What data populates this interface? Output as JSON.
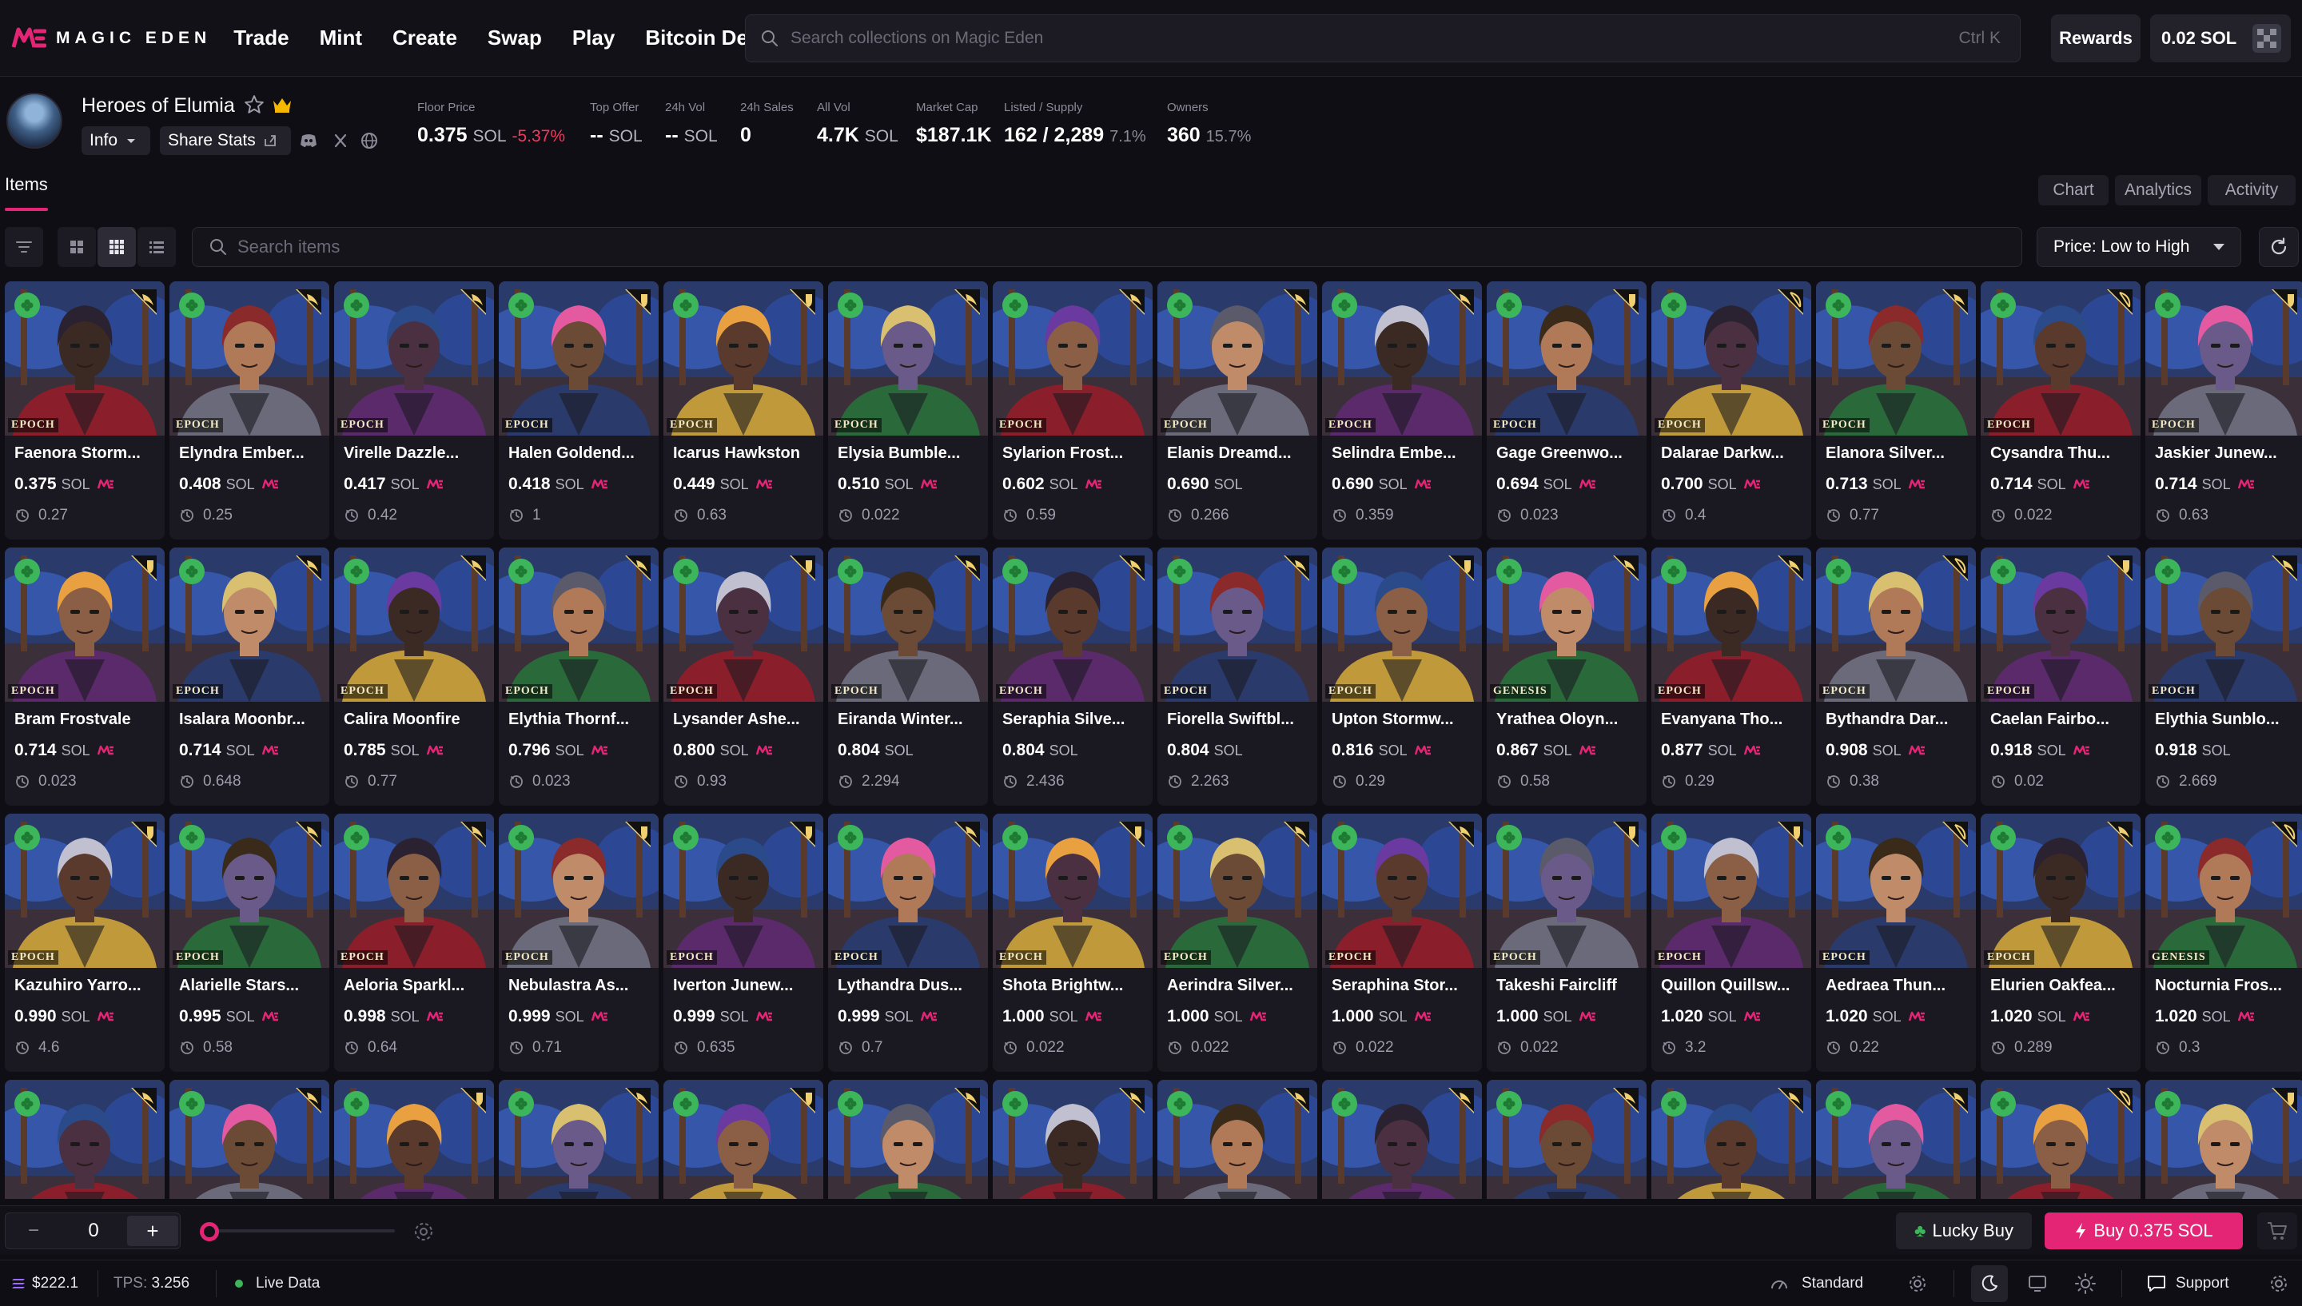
{
  "nav": {
    "brand": "MAGIC EDEN",
    "links": [
      "Trade",
      "Mint",
      "Create",
      "Swap",
      "Play",
      "Bitcoin DeFi"
    ],
    "search_placeholder": "Search collections on Magic Eden",
    "search_shortcut": "Ctrl K",
    "rewards_label": "Rewards",
    "wallet_balance": "0.02 SOL"
  },
  "collection": {
    "name": "Heroes of Elumia",
    "info_label": "Info",
    "share_label": "Share Stats",
    "stats": [
      {
        "label": "Floor Price",
        "value": "0.375",
        "unit": "SOL",
        "change": "-5.37%"
      },
      {
        "label": "Top Offer",
        "value": "--",
        "unit": "SOL"
      },
      {
        "label": "24h Vol",
        "value": "--",
        "unit": "SOL"
      },
      {
        "label": "24h Sales",
        "value": "0"
      },
      {
        "label": "All Vol",
        "value": "4.7K",
        "unit": "SOL"
      },
      {
        "label": "Market Cap",
        "value": "$187.1K"
      },
      {
        "label": "Listed / Supply",
        "value": "162 / 2,289",
        "pct": "7.1%"
      },
      {
        "label": "Owners",
        "value": "360",
        "pct": "15.7%"
      }
    ]
  },
  "tabs": {
    "items_label": "Items",
    "chart_label": "Chart",
    "analytics_label": "Analytics",
    "activity_label": "Activity"
  },
  "toolbar": {
    "search_placeholder": "Search items",
    "sort_label": "Price: Low to High"
  },
  "items": [
    {
      "name": "Faenora Storm...",
      "price": "0.375",
      "offer": "0.27",
      "badge": "EPOCH",
      "me": true,
      "icon": "wing"
    },
    {
      "name": "Elyndra Ember...",
      "price": "0.408",
      "offer": "0.25",
      "badge": "EPOCH",
      "me": true,
      "icon": "wing"
    },
    {
      "name": "Virelle Dazzle...",
      "price": "0.417",
      "offer": "0.42",
      "badge": "EPOCH",
      "me": true,
      "icon": "wing"
    },
    {
      "name": "Halen Goldend...",
      "price": "0.418",
      "offer": "1",
      "badge": "EPOCH",
      "me": true,
      "icon": "shield"
    },
    {
      "name": "Icarus Hawkston",
      "price": "0.449",
      "offer": "0.63",
      "badge": "EPOCH",
      "me": true,
      "icon": "shield"
    },
    {
      "name": "Elysia Bumble...",
      "price": "0.510",
      "offer": "0.022",
      "badge": "EPOCH",
      "me": true,
      "icon": "wing"
    },
    {
      "name": "Sylarion Frost...",
      "price": "0.602",
      "offer": "0.59",
      "badge": "EPOCH",
      "me": true,
      "icon": "wing"
    },
    {
      "name": "Elanis Dreamd...",
      "price": "0.690",
      "offer": "0.266",
      "badge": "EPOCH",
      "me": false,
      "icon": "wing"
    },
    {
      "name": "Selindra Embe...",
      "price": "0.690",
      "offer": "0.359",
      "badge": "EPOCH",
      "me": true,
      "icon": "wing"
    },
    {
      "name": "Gage Greenwo...",
      "price": "0.694",
      "offer": "0.023",
      "badge": "EPOCH",
      "me": true,
      "icon": "shield"
    },
    {
      "name": "Dalarae Darkw...",
      "price": "0.700",
      "offer": "0.4",
      "badge": "EPOCH",
      "me": true,
      "icon": "bow"
    },
    {
      "name": "Elanora Silver...",
      "price": "0.713",
      "offer": "0.77",
      "badge": "EPOCH",
      "me": true,
      "icon": "wing"
    },
    {
      "name": "Cysandra Thu...",
      "price": "0.714",
      "offer": "0.022",
      "badge": "EPOCH",
      "me": true,
      "icon": "bow"
    },
    {
      "name": "Jaskier Junew...",
      "price": "0.714",
      "offer": "0.63",
      "badge": "EPOCH",
      "me": true,
      "icon": "shield"
    },
    {
      "name": "Bram Frostvale",
      "price": "0.714",
      "offer": "0.023",
      "badge": "EPOCH",
      "me": true,
      "icon": "shield"
    },
    {
      "name": "Isalara Moonbr...",
      "price": "0.714",
      "offer": "0.648",
      "badge": "EPOCH",
      "me": true,
      "icon": "wing"
    },
    {
      "name": "Calira Moonfire",
      "price": "0.785",
      "offer": "0.77",
      "badge": "EPOCH",
      "me": true,
      "icon": "wing"
    },
    {
      "name": "Elythia Thornf...",
      "price": "0.796",
      "offer": "0.023",
      "badge": "EPOCH",
      "me": true,
      "icon": "wing"
    },
    {
      "name": "Lysander Ashe...",
      "price": "0.800",
      "offer": "0.93",
      "badge": "EPOCH",
      "me": true,
      "icon": "shield"
    },
    {
      "name": "Eiranda Winter...",
      "price": "0.804",
      "offer": "2.294",
      "badge": "EPOCH",
      "me": false,
      "icon": "wing"
    },
    {
      "name": "Seraphia Silve...",
      "price": "0.804",
      "offer": "2.436",
      "badge": "EPOCH",
      "me": false,
      "icon": "wing"
    },
    {
      "name": "Fiorella Swiftbl...",
      "price": "0.804",
      "offer": "2.263",
      "badge": "EPOCH",
      "me": false,
      "icon": "wing"
    },
    {
      "name": "Upton Stormw...",
      "price": "0.816",
      "offer": "0.29",
      "badge": "EPOCH",
      "me": true,
      "icon": "shield"
    },
    {
      "name": "Yrathea Oloyn...",
      "price": "0.867",
      "offer": "0.58",
      "badge": "GENESIS",
      "me": true,
      "icon": "wing"
    },
    {
      "name": "Evanyana Tho...",
      "price": "0.877",
      "offer": "0.29",
      "badge": "EPOCH",
      "me": true,
      "icon": "wing"
    },
    {
      "name": "Bythandra Dar...",
      "price": "0.908",
      "offer": "0.38",
      "badge": "EPOCH",
      "me": true,
      "icon": "bow"
    },
    {
      "name": "Caelan Fairbo...",
      "price": "0.918",
      "offer": "0.02",
      "badge": "EPOCH",
      "me": true,
      "icon": "shield"
    },
    {
      "name": "Elythia Sunblo...",
      "price": "0.918",
      "offer": "2.669",
      "badge": "EPOCH",
      "me": false,
      "icon": "wing"
    },
    {
      "name": "Kazuhiro Yarro...",
      "price": "0.990",
      "offer": "4.6",
      "badge": "EPOCH",
      "me": true,
      "icon": "shield"
    },
    {
      "name": "Alarielle Stars...",
      "price": "0.995",
      "offer": "0.58",
      "badge": "EPOCH",
      "me": true,
      "icon": "wing"
    },
    {
      "name": "Aeloria Sparkl...",
      "price": "0.998",
      "offer": "0.64",
      "badge": "EPOCH",
      "me": true,
      "icon": "wing"
    },
    {
      "name": "Nebulastra As...",
      "price": "0.999",
      "offer": "0.71",
      "badge": "EPOCH",
      "me": true,
      "icon": "shield"
    },
    {
      "name": "Iverton Junew...",
      "price": "0.999",
      "offer": "0.635",
      "badge": "EPOCH",
      "me": true,
      "icon": "shield"
    },
    {
      "name": "Lythandra Dus...",
      "price": "0.999",
      "offer": "0.7",
      "badge": "EPOCH",
      "me": true,
      "icon": "wing"
    },
    {
      "name": "Shota Brightw...",
      "price": "1.000",
      "offer": "0.022",
      "badge": "EPOCH",
      "me": true,
      "icon": "shield"
    },
    {
      "name": "Aerindra Silver...",
      "price": "1.000",
      "offer": "0.022",
      "badge": "EPOCH",
      "me": true,
      "icon": "wing"
    },
    {
      "name": "Seraphina Stor...",
      "price": "1.000",
      "offer": "0.022",
      "badge": "EPOCH",
      "me": true,
      "icon": "wing"
    },
    {
      "name": "Takeshi Faircliff",
      "price": "1.000",
      "offer": "0.022",
      "badge": "EPOCH",
      "me": true,
      "icon": "shield"
    },
    {
      "name": "Quillon Quillsw...",
      "price": "1.020",
      "offer": "3.2",
      "badge": "EPOCH",
      "me": true,
      "icon": "shield"
    },
    {
      "name": "Aedraea Thun...",
      "price": "1.020",
      "offer": "0.22",
      "badge": "EPOCH",
      "me": true,
      "icon": "bow"
    },
    {
      "name": "Elurien Oakfea...",
      "price": "1.020",
      "offer": "0.289",
      "badge": "EPOCH",
      "me": true,
      "icon": "wing"
    },
    {
      "name": "Nocturnia Fros...",
      "price": "1.020",
      "offer": "0.3",
      "badge": "GENESIS",
      "me": true,
      "icon": "bow"
    },
    {
      "name": "",
      "price": "",
      "offer": "",
      "badge": "",
      "me": false,
      "icon": "wing"
    },
    {
      "name": "",
      "price": "",
      "offer": "",
      "badge": "",
      "me": false,
      "icon": "wing"
    },
    {
      "name": "",
      "price": "",
      "offer": "",
      "badge": "",
      "me": false,
      "icon": "shield"
    },
    {
      "name": "",
      "price": "",
      "offer": "",
      "badge": "",
      "me": false,
      "icon": "wing"
    },
    {
      "name": "",
      "price": "",
      "offer": "",
      "badge": "",
      "me": false,
      "icon": "shield"
    },
    {
      "name": "",
      "price": "",
      "offer": "",
      "badge": "",
      "me": false,
      "icon": "wing"
    },
    {
      "name": "",
      "price": "",
      "offer": "",
      "badge": "",
      "me": false,
      "icon": "wing"
    },
    {
      "name": "",
      "price": "",
      "offer": "",
      "badge": "",
      "me": false,
      "icon": "wing"
    },
    {
      "name": "",
      "price": "",
      "offer": "",
      "badge": "",
      "me": false,
      "icon": "wing"
    },
    {
      "name": "",
      "price": "",
      "offer": "",
      "badge": "",
      "me": false,
      "icon": "wing"
    },
    {
      "name": "",
      "price": "",
      "offer": "",
      "badge": "",
      "me": false,
      "icon": "wing"
    },
    {
      "name": "",
      "price": "",
      "offer": "",
      "badge": "",
      "me": false,
      "icon": "wing"
    },
    {
      "name": "",
      "price": "",
      "offer": "",
      "badge": "",
      "me": false,
      "icon": "bow"
    },
    {
      "name": "",
      "price": "",
      "offer": "",
      "badge": "",
      "me": false,
      "icon": "shield"
    }
  ],
  "sol_unit": "SOL",
  "buybar": {
    "quantity": "0",
    "minus": "−",
    "plus": "+",
    "lucky_label": "Lucky Buy",
    "buy_label": "Buy 0.375 SOL"
  },
  "status": {
    "sol_price": "$222.1",
    "tps_label": "TPS:",
    "tps_value": "3.256",
    "live_label": "Live Data",
    "priority_label": "Standard",
    "support_label": "Support"
  },
  "colors": {
    "accent": "#e42575",
    "negative": "#f03a5f",
    "clover_green": "#3db55a",
    "background": "#0f0e14"
  }
}
